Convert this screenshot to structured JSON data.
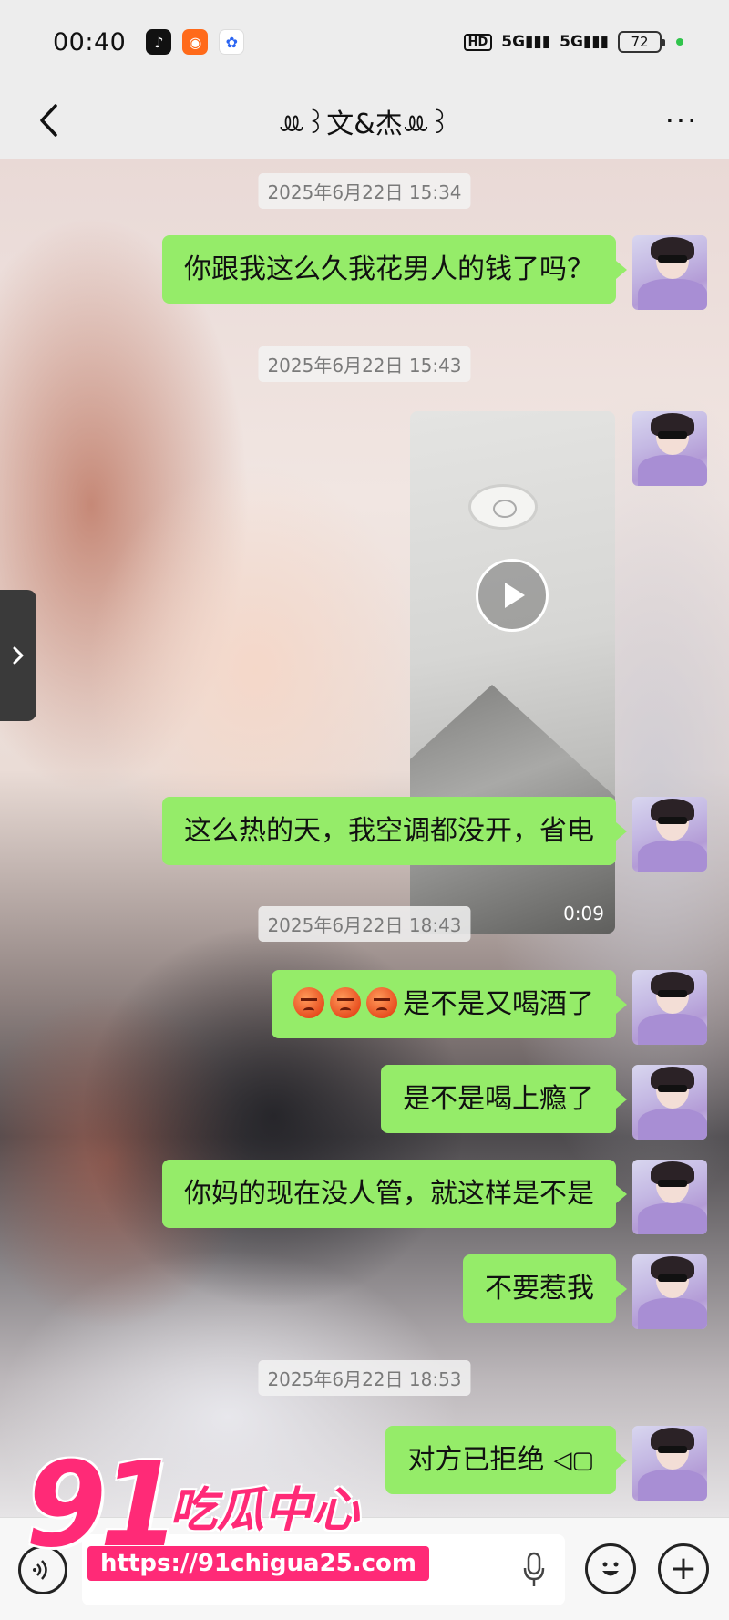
{
  "status_bar": {
    "time": "00:40",
    "signal1": "5G",
    "signal2": "5G",
    "hd": "HD",
    "battery": "72"
  },
  "nav": {
    "title": "ꔛ꒱文&杰ꔛ꒱"
  },
  "messages": [
    {
      "type": "time",
      "text": "2025年6月22日 15:34"
    },
    {
      "type": "text",
      "text": "你跟我这么久我花男人的钱了吗？"
    },
    {
      "type": "time",
      "text": "2025年6月22日 15:43"
    },
    {
      "type": "video",
      "duration": "0:09"
    },
    {
      "type": "text",
      "text": "这么热的天，我空调都没开，省电"
    },
    {
      "type": "time",
      "text": "2025年6月22日 18:43"
    },
    {
      "type": "text",
      "text": "是不是又喝酒了"
    },
    {
      "type": "text",
      "text": "是不是喝上瘾了"
    },
    {
      "type": "text",
      "text": "你妈的现在没人管，就这样是不是"
    },
    {
      "type": "text",
      "text": "不要惹我"
    },
    {
      "type": "time",
      "text": "2025年6月22日 18:53"
    },
    {
      "type": "text",
      "text": "对方已拒绝"
    }
  ],
  "watermark": {
    "number": "91",
    "name": "吃瓜中心",
    "url": "https://91chigua25.com"
  },
  "colors": {
    "bubble": "#95ec69",
    "watermark": "#ff2a77"
  },
  "icons": {
    "back": "chevron-left-icon",
    "more": "more-dots-icon",
    "voice": "voice-icon",
    "mic": "mic-icon",
    "emoji": "emoji-icon",
    "plus": "plus-icon"
  }
}
